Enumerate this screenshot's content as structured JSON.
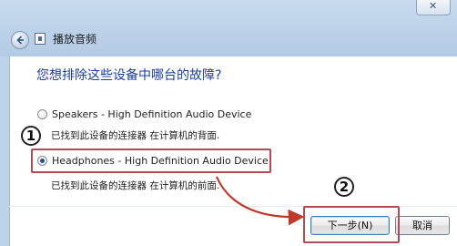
{
  "window": {
    "title": "播放音频",
    "close_label": "✕"
  },
  "question": "您想排除这些设备中哪台的故障?",
  "devices": [
    {
      "label": "Speakers - High Definition Audio Device",
      "description": "已找到此设备的连接器 在计算机的背面.",
      "selected": false
    },
    {
      "label": "Headphones - High Definition Audio Device",
      "description": "已找到此设备的连接器 在计算机的前面.",
      "selected": true
    }
  ],
  "buttons": {
    "next_label": "下一步(N)",
    "cancel_label": "取消"
  },
  "annotations": {
    "step1": "1",
    "step2": "2",
    "highlight_color": "#b34a55",
    "arrow_color": "#c0392b"
  }
}
